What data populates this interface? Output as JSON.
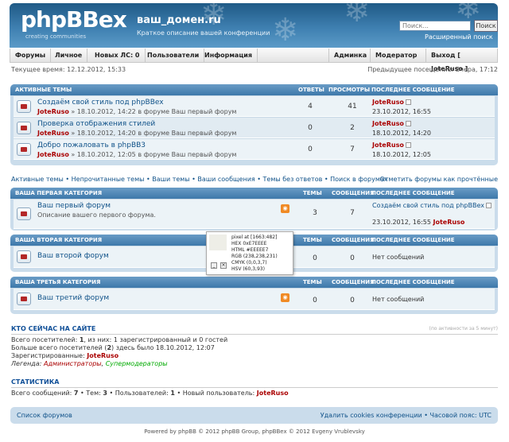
{
  "header": {
    "logo": "phpBBex",
    "logo_sub": "creating    communities",
    "site_name": "ваш_домен.ru",
    "site_desc": "Краткое описание вашей конференции",
    "search_placeholder": "Поиск...",
    "search_button": "Поиск",
    "advanced_search": "Расширенный поиск"
  },
  "nav": {
    "forums": "Форумы",
    "personal": "Личное",
    "new_pm": "Новых ЛС: 0",
    "users": "Пользователи",
    "info": "Информация",
    "admin": "Админка",
    "moderator": "Модератор",
    "logout": "Выход [ JoteRuso ]"
  },
  "time": "Текущее время: 12.12.2012, 15:33",
  "last_visit": "Предыдущее посещение: Вчера, 17:12",
  "active": {
    "header": {
      "title": "Активные темы",
      "replies": "Ответы",
      "views": "Просмотры",
      "last": "Последнее сообщение"
    },
    "rows": [
      {
        "title": "Создаём свой стиль под phpBBex",
        "author": "JoteRuso",
        "info": "» 18.10.2012, 14:22 в форуме Ваш первый форум",
        "replies": "4",
        "views": "41",
        "last_user": "JoteRuso",
        "last_time": "23.10.2012, 16:55"
      },
      {
        "title": "Проверка отображения стилей",
        "author": "JoteRuso",
        "info": "» 18.10.2012, 14:20 в форуме Ваш первый форум",
        "replies": "0",
        "views": "2",
        "last_user": "JoteRuso",
        "last_time": "18.10.2012, 14:20"
      },
      {
        "title": "Добро пожаловать в phpBB3",
        "author": "JoteRuso",
        "info": "» 18.10.2012, 12:05 в форуме Ваш первый форум",
        "replies": "0",
        "views": "7",
        "last_user": "JoteRuso",
        "last_time": "18.10.2012, 12:05"
      }
    ]
  },
  "quicklinks": "Активные темы • Непрочитанные темы • Ваши темы • Ваши сообщения • Темы без ответов • Поиск в форумах",
  "mark_read": "Отметить форумы как прочтённые",
  "cat_cols": {
    "topics": "Темы",
    "posts": "Сообщения",
    "last": "Последнее сообщение"
  },
  "categories": [
    {
      "title": "Ваша первая категория",
      "forum": "Ваш первый форум",
      "desc": "Описание вашего первого форума.",
      "topics": "3",
      "posts": "7",
      "last_line1": "Создаём свой стиль под phpBBex",
      "last_time": "23.10.2012, 16:55",
      "last_user": "JoteRuso"
    },
    {
      "title": "Ваша вторая категория",
      "forum": "Ваш второй форум",
      "topics": "0",
      "posts": "0",
      "last_line1": "Нет сообщений"
    },
    {
      "title": "Ваша третья категория",
      "forum": "Ваш третий форум",
      "topics": "0",
      "posts": "0",
      "last_line1": "Нет сообщений"
    }
  ],
  "tooltip": {
    "l1": "pixel at [1663:482]",
    "l2": "HEX 0xE7EEEE",
    "l3": "HTML #EEEEE7",
    "l4": "RGB (238,238,231)",
    "l5": "CMYK (0,0,3,7)",
    "l6": "HSV (60,3,93)",
    "swatch": "#eeeee7"
  },
  "online": {
    "title": "Кто сейчас на сайте",
    "note": "(по активности за 5 минут)",
    "l1_pre": "Всего посетителей: ",
    "l1_n": "1",
    "l1_post": ", из них: 1 зарегистрированный и 0 гостей",
    "l2_pre": "Больше всего посетителей (",
    "l2_n": "2",
    "l2_post": ") здесь было 18.10.2012, 12:07",
    "l3_pre": "Зарегистрированные: ",
    "l3_user": "JoteRuso",
    "legend_pre": "Легенда: ",
    "legend_admins": "Администраторы",
    "legend_sep": ", ",
    "legend_mods": "Супермодераторы"
  },
  "stats": {
    "title": "Статистика",
    "line_pre": "Всего сообщений: ",
    "posts": "7",
    "t_pre": " • Тем: ",
    "topics": "3",
    "u_pre": " • Пользователей: ",
    "users": "1",
    "n_pre": " • Новый пользователь: ",
    "newest": "JoteRuso"
  },
  "footer": {
    "left": "Список форумов",
    "right": "Удалить cookies конференции • Часовой пояс: UTC",
    "copyright": "Powered by phpBB © 2012 phpBB Group, phpBBex © 2012 Evgeny Vrublevsky"
  }
}
